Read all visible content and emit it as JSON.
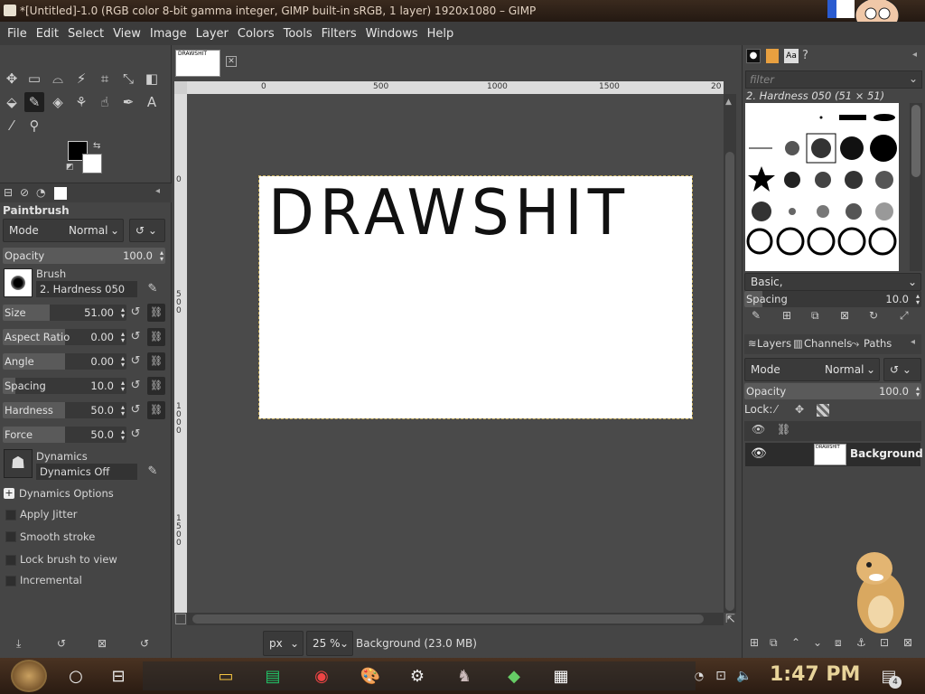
{
  "window": {
    "title": "*[Untitled]-1.0 (RGB color 8-bit gamma integer, GIMP built-in sRGB, 1 layer) 1920x1080 – GIMP"
  },
  "menu": [
    "File",
    "Edit",
    "Select",
    "View",
    "Image",
    "Layer",
    "Colors",
    "Tools",
    "Filters",
    "Windows",
    "Help"
  ],
  "toolbox": {
    "tool_name": "Paintbrush",
    "mode_label": "Mode",
    "mode_value": "Normal",
    "opacity": {
      "label": "Opacity",
      "value": "100.0"
    },
    "brush": {
      "label": "Brush",
      "value": "2. Hardness 050"
    },
    "sliders": [
      {
        "label": "Size",
        "value": "51.00",
        "fill": 0.38
      },
      {
        "label": "Aspect Ratio",
        "value": "0.00",
        "fill": 0.5
      },
      {
        "label": "Angle",
        "value": "0.00",
        "fill": 0.5
      },
      {
        "label": "Spacing",
        "value": "10.0",
        "fill": 0.1
      },
      {
        "label": "Hardness",
        "value": "50.0",
        "fill": 0.5
      },
      {
        "label": "Force",
        "value": "50.0",
        "fill": 0.5
      }
    ],
    "dynamics": {
      "label": "Dynamics",
      "value": "Dynamics Off"
    },
    "dynamics_options": "Dynamics Options",
    "options": [
      "Apply Jitter",
      "Smooth stroke",
      "Lock brush to view",
      "Incremental"
    ]
  },
  "canvas": {
    "image_text": "DRAWSHIT",
    "tab_thumb_text": "DRAWSHIT",
    "hruler_ticks": [
      "0",
      "500",
      "1000",
      "1500",
      "20"
    ],
    "vruler_ticks": [
      "0",
      "500",
      "1000",
      "1500"
    ]
  },
  "status": {
    "unit": "px",
    "zoom": "25 %",
    "layer_info": "Background (23.0 MB)"
  },
  "brushes": {
    "filter_placeholder": "filter",
    "title": "2. Hardness 050 (51 × 51)",
    "tag": "Basic,",
    "spacing": {
      "label": "Spacing",
      "value": "10.0"
    }
  },
  "layers": {
    "tabs": [
      "Layers",
      "Channels",
      "Paths"
    ],
    "mode_label": "Mode",
    "mode_value": "Normal",
    "opacity": {
      "label": "Opacity",
      "value": "100.0"
    },
    "lock_label": "Lock:",
    "layer_name": "Background"
  },
  "taskbar": {
    "time": "1:47 PM",
    "notification_count": "4"
  },
  "colors": {
    "fg": "#000000",
    "bg": "#ffffff"
  }
}
